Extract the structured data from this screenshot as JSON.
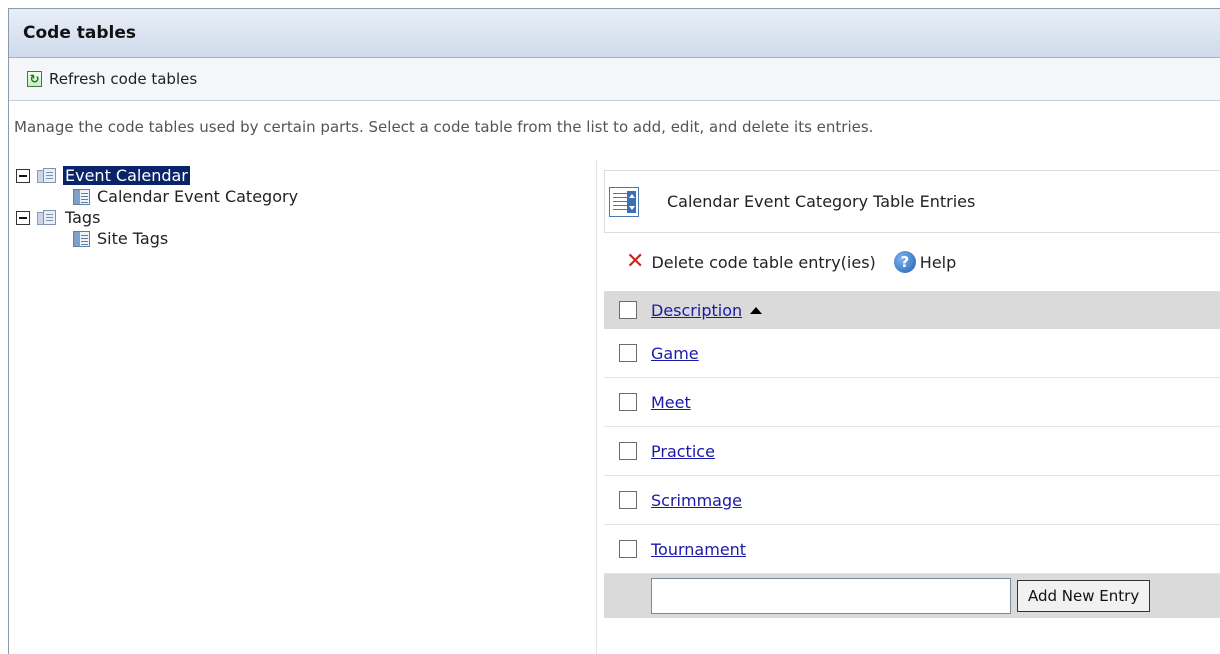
{
  "page": {
    "title": "Code tables"
  },
  "toolbar": {
    "refresh_label": "Refresh code tables",
    "refresh_icon": "refresh-icon"
  },
  "description": "Manage the code tables used by certain parts. Select a code table from the list to add, edit, and delete its entries.",
  "tree": {
    "groups": [
      {
        "label": "Event Calendar",
        "expanded": true,
        "selected": true,
        "children": [
          {
            "label": "Calendar Event Category"
          }
        ]
      },
      {
        "label": "Tags",
        "expanded": true,
        "selected": false,
        "children": [
          {
            "label": "Site Tags"
          }
        ]
      }
    ]
  },
  "panel": {
    "title": "Calendar Event Category Table Entries",
    "actions": {
      "delete_label": "Delete code table entry(ies)",
      "help_label": "Help"
    },
    "grid": {
      "column_header": "Description",
      "sort": "ascending",
      "rows": [
        "Game",
        "Meet",
        "Practice",
        "Scrimmage",
        "Tournament"
      ],
      "new_entry_value": "",
      "add_button_label": "Add New Entry"
    }
  },
  "colors": {
    "selection": "#0a246a",
    "link": "#1a1aa6",
    "delete": "#d0261a",
    "grid_header": "#dadada"
  }
}
